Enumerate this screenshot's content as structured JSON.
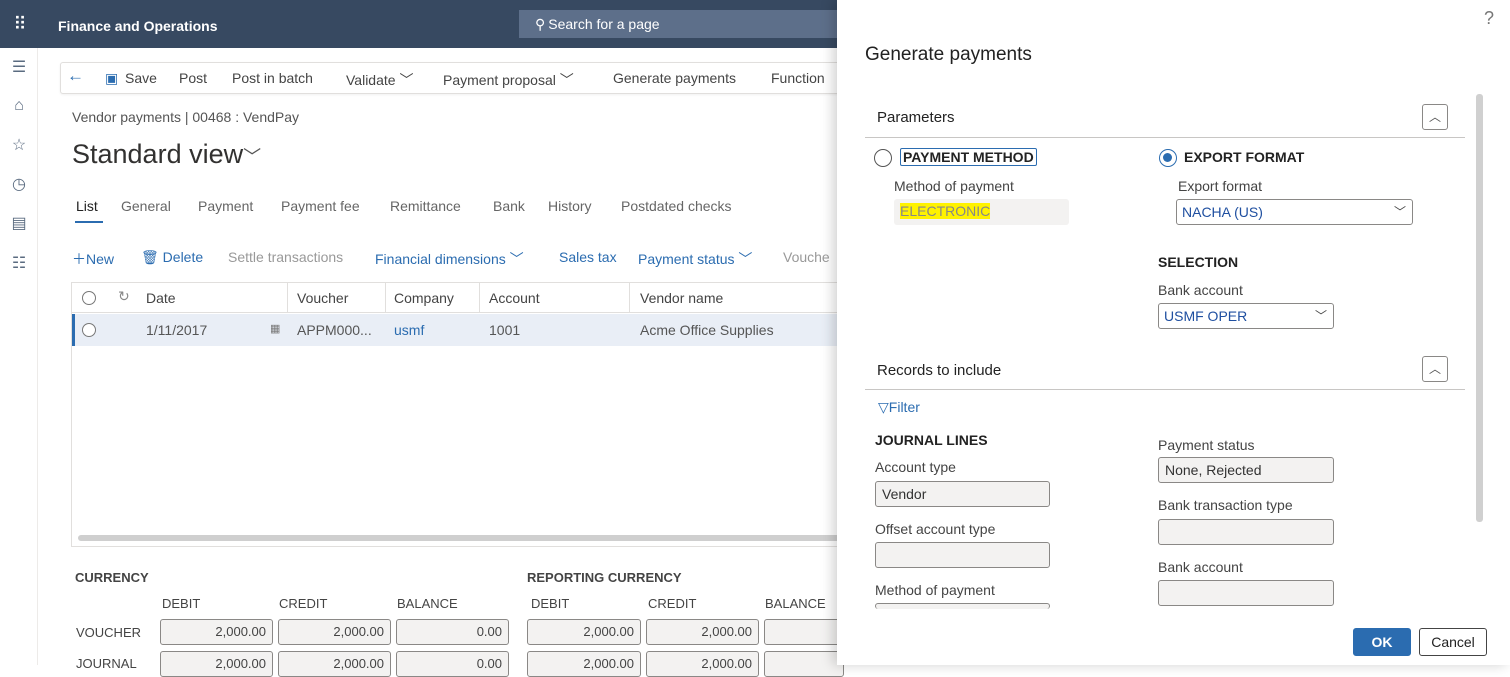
{
  "topbar": {
    "app_title": "Finance and Operations",
    "search_placeholder": "Search for a page"
  },
  "actionbar": {
    "save": "Save",
    "post": "Post",
    "post_in_batch": "Post in batch",
    "validate": "Validate",
    "payment_proposal": "Payment proposal",
    "generate_payments": "Generate payments",
    "functions": "Function"
  },
  "page": {
    "breadcrumb": "Vendor payments  |  00468 : VendPay",
    "view_title": "Standard view"
  },
  "tabs": [
    "List",
    "General",
    "Payment",
    "Payment fee",
    "Remittance",
    "Bank",
    "History",
    "Postdated checks"
  ],
  "gridtools": {
    "new": "New",
    "delete": "Delete",
    "settle": "Settle transactions",
    "fin_dims": "Financial dimensions",
    "sales_tax": "Sales tax",
    "payment_status": "Payment status",
    "voucher": "Vouche"
  },
  "grid": {
    "columns": [
      "Date",
      "Voucher",
      "Company",
      "Account",
      "Vendor name"
    ],
    "rows": [
      {
        "date": "1/11/2017",
        "voucher": "APPM000...",
        "company": "usmf",
        "account": "1001",
        "vendor": "Acme Office Supplies"
      }
    ]
  },
  "totals": {
    "currency_label": "CURRENCY",
    "reporting_label": "REPORTING CURRENCY",
    "cols": [
      "DEBIT",
      "CREDIT",
      "BALANCE",
      "DEBIT",
      "CREDIT",
      "BALANCE"
    ],
    "voucher_label": "VOUCHER",
    "journal_label": "JOURNAL",
    "voucher": [
      "2,000.00",
      "2,000.00",
      "0.00",
      "2,000.00",
      "2,000.00"
    ],
    "journal": [
      "2,000.00",
      "2,000.00",
      "0.00",
      "2,000.00",
      "2,000.00"
    ]
  },
  "panel": {
    "help": "?",
    "title": "Generate payments",
    "parameters": "Parameters",
    "payment_method": "PAYMENT METHOD",
    "method_of_payment_label": "Method of payment",
    "method_of_payment_value": "ELECTRONIC",
    "export_format": "EXPORT FORMAT",
    "export_format_label": "Export format",
    "export_format_value": "NACHA (US)",
    "selection": "SELECTION",
    "bank_account_label": "Bank account",
    "bank_account_value": "USMF OPER",
    "records": "Records to include",
    "filter": "Filter",
    "journal_lines": "JOURNAL LINES",
    "account_type_label": "Account type",
    "account_type_value": "Vendor",
    "offset_account_type_label": "Offset account type",
    "method_of_payment2_label": "Method of payment",
    "payment_status_label": "Payment status",
    "payment_status_value": "None, Rejected",
    "bank_transaction_type_label": "Bank transaction type",
    "bank_account2_label": "Bank account",
    "ok": "OK",
    "cancel": "Cancel"
  },
  "colors": {
    "topbar": "#374961",
    "accent": "#2b6cb0",
    "highlight": "#fff200"
  }
}
